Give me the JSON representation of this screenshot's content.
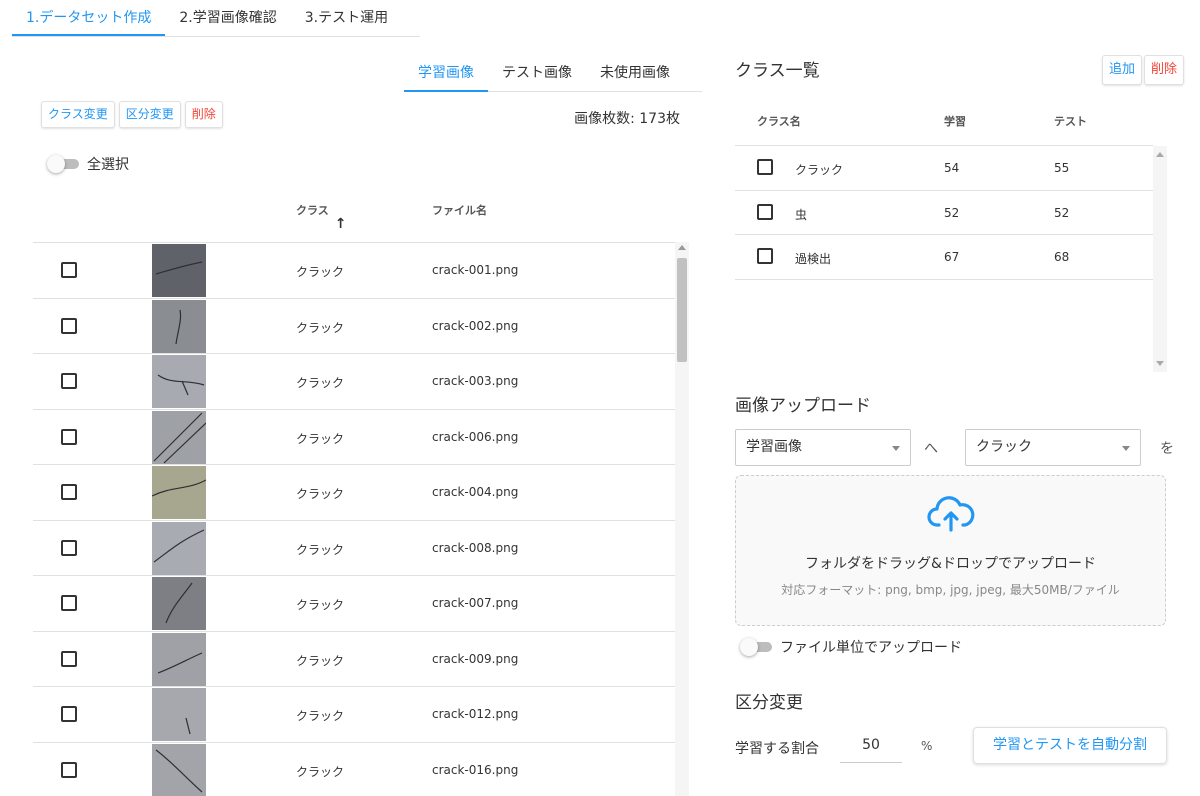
{
  "top_tabs": [
    "1.データセット作成",
    "2.学習画像確認",
    "3.テスト運用"
  ],
  "image_tabs": [
    "学習画像",
    "テスト画像",
    "未使用画像"
  ],
  "image_actions": {
    "change_class": "クラス変更",
    "change_split": "区分変更",
    "delete": "削除"
  },
  "image_count": "画像枚数: 173枚",
  "select_all_label": "全選択",
  "image_table": {
    "col_class": "クラス",
    "col_filename": "ファイル名",
    "sort_icon": "arrow-up-icon",
    "rows": [
      {
        "class": "クラック",
        "file": "crack-001.png"
      },
      {
        "class": "クラック",
        "file": "crack-002.png"
      },
      {
        "class": "クラック",
        "file": "crack-003.png"
      },
      {
        "class": "クラック",
        "file": "crack-006.png"
      },
      {
        "class": "クラック",
        "file": "crack-004.png"
      },
      {
        "class": "クラック",
        "file": "crack-008.png"
      },
      {
        "class": "クラック",
        "file": "crack-007.png"
      },
      {
        "class": "クラック",
        "file": "crack-009.png"
      },
      {
        "class": "クラック",
        "file": "crack-012.png"
      },
      {
        "class": "クラック",
        "file": "crack-016.png"
      }
    ]
  },
  "class_list": {
    "title": "クラス一覧",
    "add_label": "追加",
    "delete_label": "削除",
    "col_name": "クラス名",
    "col_train": "学習",
    "col_test": "テスト",
    "rows": [
      {
        "name": "クラック",
        "train": "54",
        "test": "55"
      },
      {
        "name": "虫",
        "train": "52",
        "test": "52"
      },
      {
        "name": "過検出",
        "train": "67",
        "test": "68"
      }
    ]
  },
  "upload": {
    "title": "画像アップロード",
    "target_select": "学習画像",
    "to_text": "へ",
    "class_select": "クラック",
    "wo_text": "を",
    "drop_main": "フォルダをドラッグ&ドロップでアップロード",
    "drop_sub": "対応フォーマット: png, bmp, jpg, jpeg, 最大50MB/ファイル",
    "file_unit_label": "ファイル単位でアップロード",
    "icon": "cloud-upload-icon"
  },
  "split": {
    "title": "区分変更",
    "ratio_label": "学習する割合",
    "ratio_value": "50",
    "ratio_unit": "%",
    "auto_button": "学習とテストを自動分割"
  },
  "colors": {
    "accent": "#2196f3",
    "danger": "#f44336"
  }
}
